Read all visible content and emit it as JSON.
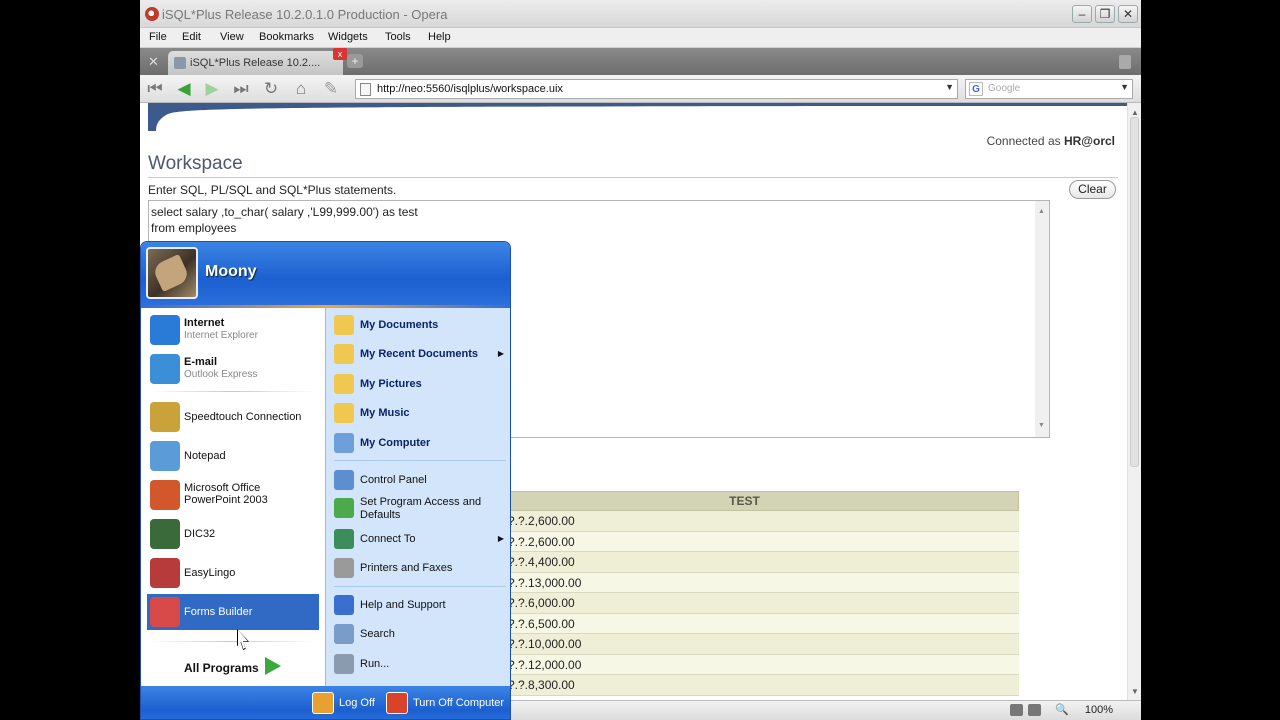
{
  "window": {
    "title": "iSQL*Plus Release 10.2.0.1.0 Production - Opera",
    "menu": [
      "File",
      "Edit",
      "View",
      "Bookmarks",
      "Widgets",
      "Tools",
      "Help"
    ]
  },
  "tab": {
    "label": "iSQL*Plus Release 10.2....",
    "close": "x",
    "new_tab": "+"
  },
  "toolbar": {
    "url": "http://neo:5560/isqlplus/workspace.uix",
    "search_placeholder": "Google",
    "search_engine_letter": "G"
  },
  "page": {
    "connected_prefix": "Connected as ",
    "connected_user": "HR@orcl",
    "title": "Workspace",
    "prompt": "Enter SQL, PL/SQL and SQL*Plus statements.",
    "clear_label": "Clear",
    "sql_line1": "select salary ,to_char( salary ,'L99,999.00') as test",
    "sql_line2": "from employees",
    "results_header": "TEST",
    "results": [
      "?.?.2,600.00",
      "?.?.2,600.00",
      "?.?.4,400.00",
      "?.?.13,000.00",
      "?.?.6,000.00",
      "?.?.6,500.00",
      "?.?.10,000.00",
      "?.?.12,000.00",
      "?.?.8,300.00"
    ]
  },
  "status": {
    "zoom": "100%"
  },
  "start_menu": {
    "user": "Moony",
    "left_pinned": [
      {
        "title": "Internet",
        "subtitle": "Internet Explorer",
        "icon": "internet-explorer-icon",
        "color": "#2a7ad8"
      },
      {
        "title": "E-mail",
        "subtitle": "Outlook Express",
        "icon": "outlook-express-icon",
        "color": "#3b8fd6"
      }
    ],
    "left_recent": [
      {
        "label": "Speedtouch Connection",
        "icon": "speedtouch-icon",
        "color": "#c9a23a"
      },
      {
        "label": "Notepad",
        "icon": "notepad-icon",
        "color": "#5a9bd8"
      },
      {
        "label": "Microsoft Office PowerPoint 2003",
        "icon": "powerpoint-icon",
        "color": "#d2572b"
      },
      {
        "label": "DIC32",
        "icon": "dic32-books-icon",
        "color": "#3a6a3a"
      },
      {
        "label": "EasyLingo",
        "icon": "easylingo-globe-icon",
        "color": "#b83b3b"
      },
      {
        "label": "Forms Builder",
        "icon": "forms-builder-icon",
        "color": "#d84a4a"
      }
    ],
    "all_programs": "All Programs",
    "right_places": [
      {
        "label": "My Documents",
        "icon": "my-documents-folder-icon",
        "color": "#f0c850",
        "chevron": false
      },
      {
        "label": "My Recent Documents",
        "icon": "recent-documents-folder-icon",
        "color": "#f0c850",
        "chevron": true
      },
      {
        "label": "My Pictures",
        "icon": "my-pictures-folder-icon",
        "color": "#f0c850",
        "chevron": false
      },
      {
        "label": "My Music",
        "icon": "my-music-folder-icon",
        "color": "#f0c850",
        "chevron": false
      },
      {
        "label": "My Computer",
        "icon": "my-computer-icon",
        "color": "#6f9fd8",
        "chevron": false
      }
    ],
    "right_settings": [
      {
        "label": "Control Panel",
        "icon": "control-panel-icon",
        "color": "#5d8ed0",
        "chevron": false
      },
      {
        "label": "Set Program Access and Defaults",
        "icon": "program-access-icon",
        "color": "#4caa4c",
        "chevron": false
      },
      {
        "label": "Connect To",
        "icon": "connect-to-icon",
        "color": "#3c8c5c",
        "chevron": true
      },
      {
        "label": "Printers and Faxes",
        "icon": "printers-icon",
        "color": "#9a9a9a",
        "chevron": false
      }
    ],
    "right_help": [
      {
        "label": "Help and Support",
        "icon": "help-icon",
        "color": "#3a6fd0"
      },
      {
        "label": "Search",
        "icon": "search-icon",
        "color": "#7a9cc8"
      },
      {
        "label": "Run...",
        "icon": "run-icon",
        "color": "#8a9bb0"
      }
    ],
    "footer": {
      "log_off": "Log Off",
      "turn_off": "Turn Off Computer"
    }
  }
}
